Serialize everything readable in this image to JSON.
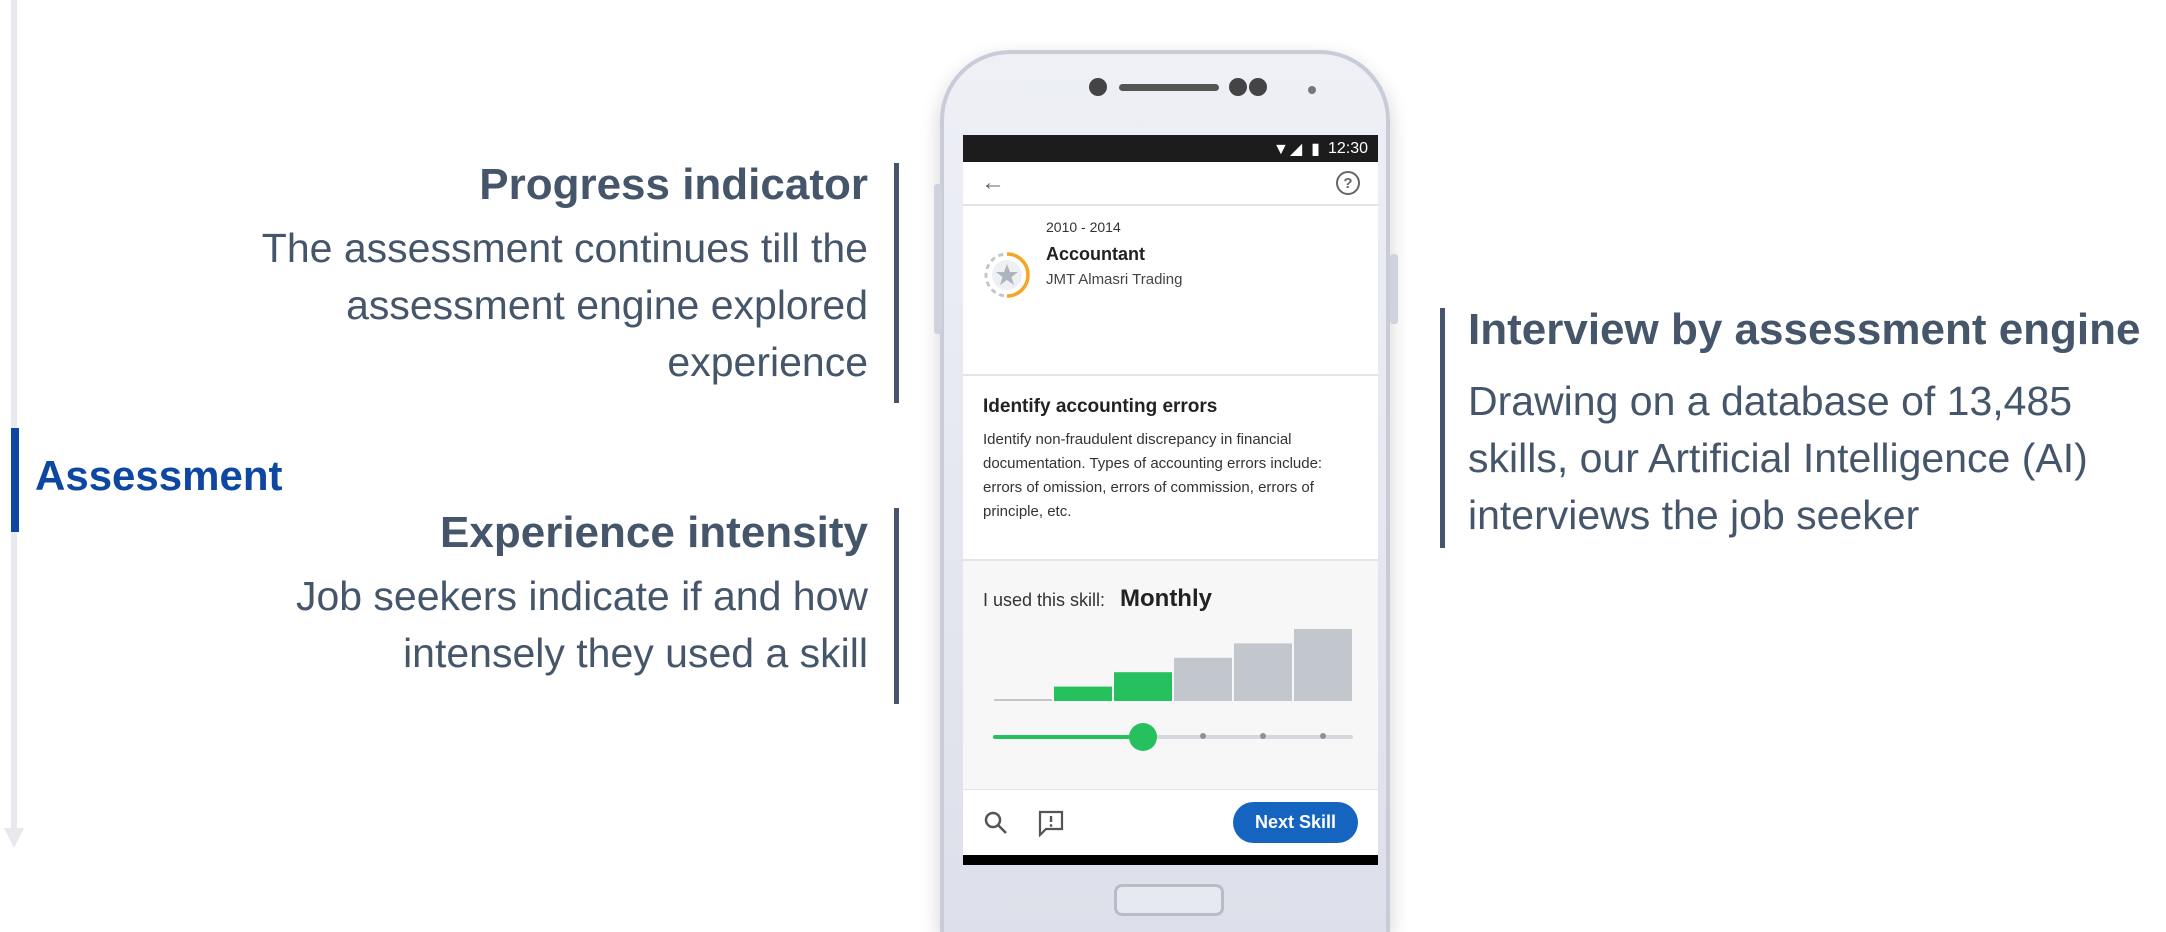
{
  "section_label": "Assessment",
  "callouts": {
    "progress": {
      "title": "Progress indicator",
      "lines": [
        "The assessment continues till the",
        "assessment engine explored",
        "experience"
      ]
    },
    "intensity": {
      "title": "Experience intensity",
      "lines": [
        "Job seekers indicate if and how",
        "intensely they used a skill"
      ]
    },
    "interview": {
      "title": "Interview by assessment engine",
      "lines": [
        "Drawing on a database of 13,485",
        "skills, our Artificial Intelligence (AI)",
        "interviews the job seeker"
      ]
    }
  },
  "phone": {
    "status_time": "12:30",
    "job": {
      "years": "2010 - 2014",
      "role": "Accountant",
      "company": "JMT Almasri Trading"
    },
    "skill": {
      "name": "Identify accounting errors",
      "lines": [
        "Identify non-fraudulent discrepancy in financial",
        "documentation. Types of accounting errors include:",
        "errors of omission, errors of commission, errors of",
        "principle, etc."
      ]
    },
    "usage": {
      "question": "I used this skill:",
      "answer": "Monthly",
      "levels": [
        0,
        1,
        2,
        3,
        4,
        5
      ],
      "selected_level": 2,
      "filled_color": "#27c05e",
      "empty_color": "#c2c6cd"
    },
    "next_button": "Next Skill",
    "icons": {
      "back": "back-arrow-icon",
      "help": "help-icon",
      "search": "search-icon",
      "feedback": "feedback-icon"
    }
  },
  "colors": {
    "accent": "#0d47a1",
    "text": "#45566b",
    "button": "#1565c0",
    "green": "#27c05e"
  }
}
